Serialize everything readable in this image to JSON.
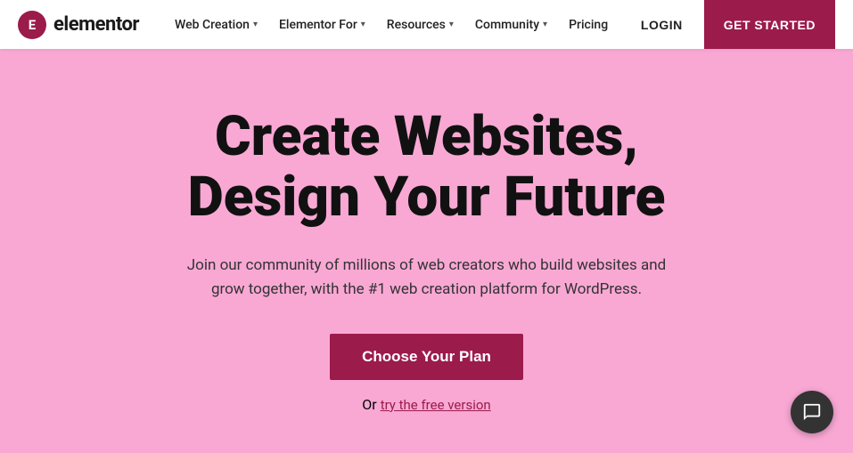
{
  "logo": {
    "icon_text": "E",
    "brand_name": "elementor"
  },
  "navbar": {
    "items": [
      {
        "label": "Web Creation",
        "has_dropdown": true
      },
      {
        "label": "Elementor For",
        "has_dropdown": true
      },
      {
        "label": "Resources",
        "has_dropdown": true
      },
      {
        "label": "Community",
        "has_dropdown": true
      },
      {
        "label": "Pricing",
        "has_dropdown": false
      }
    ],
    "login_label": "LOGIN",
    "get_started_label": "GET STARTED"
  },
  "hero": {
    "title_line1": "Create Websites,",
    "title_line2": "Design Your Future",
    "subtitle": "Join our community of millions of web creators who build websites and grow together, with the #1 web creation platform for WordPress.",
    "cta_button": "Choose Your Plan",
    "free_prefix": "Or ",
    "free_link": "try the free version"
  },
  "chat": {
    "label": "chat-support"
  }
}
